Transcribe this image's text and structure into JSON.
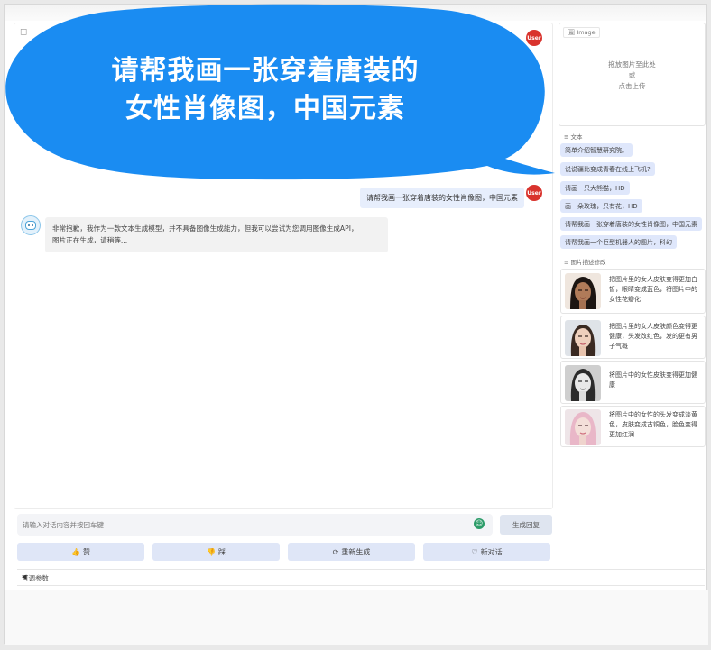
{
  "overlay": {
    "line1": "请帮我画一张穿着唐装的",
    "line2": "女性肖像图，中国元素"
  },
  "chat": {
    "user_avatar_text": "User",
    "messages": [
      {
        "role": "user",
        "text": "请帮我画一张穿着唐装的女性肖像图，中国元素"
      },
      {
        "role": "bot",
        "line1": "非常抱歉，我作为一款文本生成模型，并不具备图像生成能力，但我可以尝试为您调用图像生成API，",
        "line2": "图片正在生成，请稍等..."
      }
    ]
  },
  "input": {
    "placeholder": "请输入对话内容并按回车键",
    "generate_label": "生成回复"
  },
  "actions": [
    {
      "icon": "thumbs-up-icon",
      "glyph": "👍",
      "label": "赞"
    },
    {
      "icon": "thumbs-down-icon",
      "glyph": "👎",
      "label": "踩"
    },
    {
      "icon": "regenerate-icon",
      "glyph": "⟳",
      "label": "重新生成"
    },
    {
      "icon": "new-chat-icon",
      "glyph": "♡",
      "label": "新对话"
    }
  ],
  "params": {
    "label": "可调参数",
    "toggle": "◀"
  },
  "image_upload": {
    "tab": "Image",
    "hint1": "拖放图片至此处",
    "hint2": "或",
    "hint3": "点击上传"
  },
  "prompts": {
    "label": "文本",
    "items": [
      "简单介绍智慧研究院。",
      "说说疆比变成青春在线上飞机?",
      "请画一只大熊猫，HD",
      "画一朵玫瑰，只有花，HD",
      "请帮我画一张穿着唐装的女性肖像图，中国元素",
      "请帮我画一个巨型机器人的图片，科幻"
    ]
  },
  "examples": {
    "label": "图片描述修改",
    "items": [
      {
        "text": "把图片里的女人皮肤变得更加白皙，眼睛变成蓝色，将图片中的女性花瓣化"
      },
      {
        "text": "把图片里的女人皮肤颜色变得更健康，头发改红色，发的更有男子气概"
      },
      {
        "text": "将图片中的女性皮肤变得更加健康"
      },
      {
        "text": "将图片中的女性的头发变成淡黄色，皮肤变成古铜色，脸色变得更加红润"
      }
    ]
  },
  "colors": {
    "speech_bubble": "#1a8cf2",
    "user_bubble": "#e7eefc",
    "bot_bubble": "#f2f2f2",
    "avatar_user": "#d9332d",
    "action_button": "#dfe6f7"
  }
}
